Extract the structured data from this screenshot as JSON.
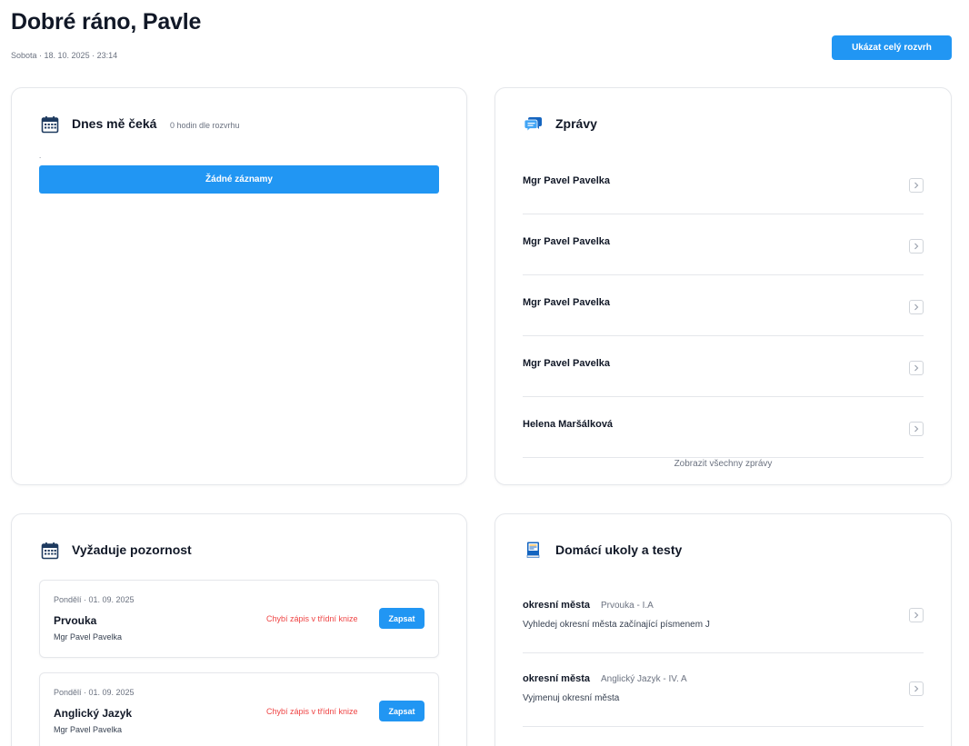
{
  "header": {
    "greeting": "Dobré ráno, Pavle",
    "date": "Sobota · 18. 10. 2025 · 23:14",
    "schedule_button": "Ukázat celý rozvrh"
  },
  "today": {
    "title": "Dnes mě čeká",
    "subtitle": "0 hodin dle rozvrhu",
    "dot": ".",
    "empty_label": "Žádné záznamy"
  },
  "messages": {
    "title": "Zprávy",
    "items": [
      {
        "sender": "Mgr Pavel Pavelka"
      },
      {
        "sender": "Mgr Pavel Pavelka"
      },
      {
        "sender": "Mgr Pavel Pavelka"
      },
      {
        "sender": "Mgr Pavel Pavelka"
      },
      {
        "sender": "Helena Maršálková"
      }
    ],
    "show_all": "Zobrazit všechny zprávy"
  },
  "attention": {
    "title": "Vyžaduje pozornost",
    "items": [
      {
        "date": "Pondělí · 01. 09. 2025",
        "subject": "Prvouka",
        "teacher": "Mgr Pavel Pavelka",
        "warning": "Chybí zápis v třídní knize",
        "action": "Zapsat"
      },
      {
        "date": "Pondělí · 01. 09. 2025",
        "subject": "Anglický Jazyk",
        "teacher": "Mgr Pavel Pavelka",
        "warning": "Chybí zápis v třídní knize",
        "action": "Zapsat"
      }
    ]
  },
  "homework": {
    "title": "Domácí ukoly a testy",
    "items": [
      {
        "title": "okresní města",
        "subject": "Prvouka - I.A",
        "description": "Vyhledej okresní města začínající písmenem J"
      },
      {
        "title": "okresní města",
        "subject": "Anglický Jazyk - IV. A",
        "description": "Vyjmenuj okresní města"
      }
    ]
  },
  "colors": {
    "accent": "#2196f3",
    "warning": "#ef4444",
    "border": "#e5e7eb"
  },
  "icons": {
    "today": "calendar-icon",
    "messages": "chat-bubbles-icon",
    "attention": "calendar-icon",
    "homework": "book-icon",
    "row_action": "chevron-right-icon"
  }
}
